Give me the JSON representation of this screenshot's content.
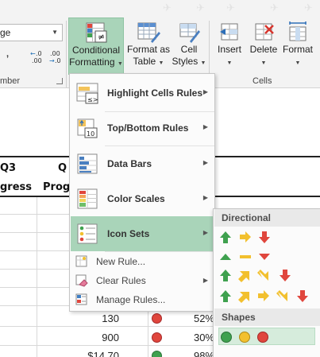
{
  "ribbon": {
    "number_format_value": "ge",
    "comma_label": ",",
    "increase_decimal_label": "←.0\n.00",
    "decrease_decimal_label": ".00\n→.0",
    "number_group_label": "mber",
    "conditional_formatting_label_1": "Conditional",
    "conditional_formatting_label_2": "Formatting",
    "format_as_table_label_1": "Format as",
    "format_as_table_label_2": "Table",
    "cell_styles_label_1": "Cell",
    "cell_styles_label_2": "Styles",
    "insert_label": "Insert",
    "delete_label": "Delete",
    "format_label": "Format",
    "cells_group_label": "Cells"
  },
  "sheet": {
    "headers_row1": [
      "Q3",
      "Q"
    ],
    "headers_row2": [
      "gress",
      "Prog"
    ],
    "rows": [
      {
        "value": "130",
        "percent": "52%",
        "icon": "red"
      },
      {
        "value": "900",
        "percent": "30%",
        "icon": "red"
      },
      {
        "value": "$14 70",
        "percent": "98%",
        "icon": "green"
      }
    ]
  },
  "menu": {
    "items": [
      {
        "label": "Highlight Cells Rules",
        "accel": "H"
      },
      {
        "label": "Top/Bottom Rules",
        "accel": "T"
      },
      {
        "label": "Data Bars",
        "accel": "D"
      },
      {
        "label": "Color Scales",
        "accel": "S"
      },
      {
        "label": "Icon Sets",
        "accel": "I"
      }
    ],
    "small_items": [
      {
        "label": "New Rule..."
      },
      {
        "label": "Clear Rules"
      },
      {
        "label": "Manage Rules..."
      }
    ]
  },
  "icon_sets": {
    "directional_header": "Directional",
    "shapes_header": "Shapes",
    "colors": {
      "green": "#3fa14f",
      "yellow": "#f2c02e",
      "red": "#e0463d",
      "accent": "#a9d4b9"
    }
  }
}
